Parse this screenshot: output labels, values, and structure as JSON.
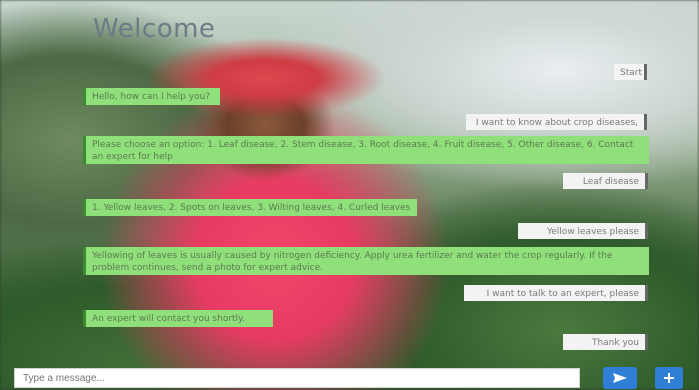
{
  "header": {
    "title": "Welcome"
  },
  "messages": [
    {
      "role": "user",
      "text": "Start"
    },
    {
      "role": "bot",
      "text": "Hello, how can I help you?"
    },
    {
      "role": "user",
      "text": "I want to know about crop diseases, please"
    },
    {
      "role": "bot",
      "text": "Please choose an option: 1. Leaf disease, 2. Stem disease, 3. Root disease, 4. Fruit disease, 5. Other disease, 6. Contact an expert for help"
    },
    {
      "role": "user",
      "text": "Leaf disease"
    },
    {
      "role": "bot",
      "text": "1. Yellow leaves, 2. Spots on leaves, 3. Wilting leaves, 4. Curled leaves"
    },
    {
      "role": "user",
      "text": "Yellow leaves please"
    },
    {
      "role": "bot",
      "text": "Yellowing of leaves is usually caused by nitrogen deficiency. Apply urea fertilizer and water the crop regularly. If the problem continues, send a photo for expert advice."
    },
    {
      "role": "user",
      "text": "I want to talk to an expert, please"
    },
    {
      "role": "bot",
      "text": "An expert will contact you shortly."
    },
    {
      "role": "user",
      "text": "Thank you"
    }
  ],
  "composer": {
    "placeholder": "Type a message..."
  },
  "icons": {
    "send": "send-icon",
    "add": "plus-icon"
  },
  "colors": {
    "bot_bubble": "#8fe07a",
    "user_bubble": "#f3f3f3",
    "accent": "#2f7fd6"
  }
}
